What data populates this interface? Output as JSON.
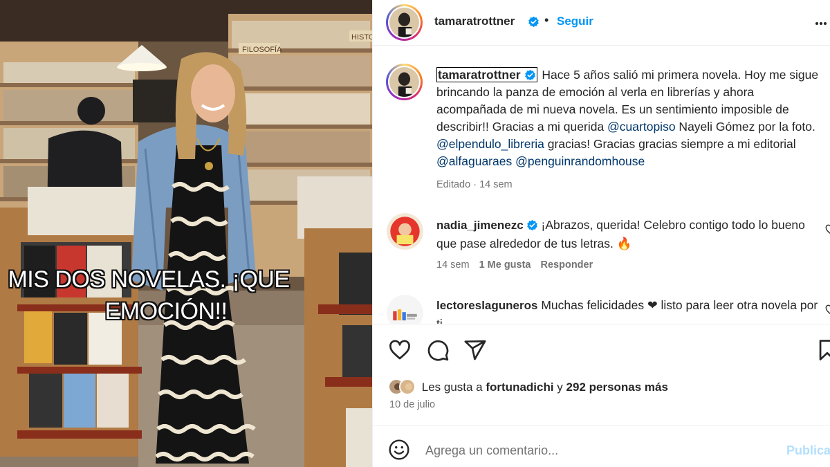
{
  "photo": {
    "overlay_line_1": "MIS DOS NOVELAS. ¡QUE",
    "overlay_line_2": "EMOCIÓN!!",
    "bookstore_sign": "FILOSOFÍA",
    "bookstore_sign_2": "HISTO"
  },
  "post": {
    "author": "tamaratrottner",
    "dot": "•",
    "follow_label": "Seguir",
    "caption": {
      "t1": " Hace 5 años salió mi primera novela. Hoy me sigue brincando la panza de emoción al verla en librerías y ahora acompañada de mi nueva novela. Es un sentimiento imposible de describir!! Gracias a mi querida ",
      "m1": "@cuartopiso",
      "t2": " Nayeli Gómez por la foto. ",
      "m2": "@elpendulo_libreria",
      "t3": " gracias! Gracias gracias siempre a mi editorial ",
      "m3": "@alfaguaraes",
      "t4": " ",
      "m4": "@penguinrandomhouse"
    },
    "caption_meta": "Editado · 14 sem"
  },
  "comments": [
    {
      "user": "nadia_jimenezc",
      "text": " ¡Abrazos, querida! Celebro contigo todo lo bueno que pase alrededor de tus letras. 🔥",
      "time": "14 sem",
      "likes": "1 Me gusta",
      "reply": "Responder"
    },
    {
      "user": "lectoreslaguneros",
      "text": " Muchas felicidades ❤ listo para leer otra novela por ti"
    }
  ],
  "likes": {
    "prefix": "Les gusta a ",
    "user": "fortunadichi",
    "mid": " y ",
    "count": "292 personas más"
  },
  "date": "10 de julio",
  "comment_bar": {
    "placeholder": "Agrega un comentario...",
    "publish_label": "Publicar"
  },
  "colors": {
    "link_blue": "#0095f6",
    "mention": "#00376b",
    "verified": "#0095f6",
    "publish_disabled": "#b2dffc"
  }
}
